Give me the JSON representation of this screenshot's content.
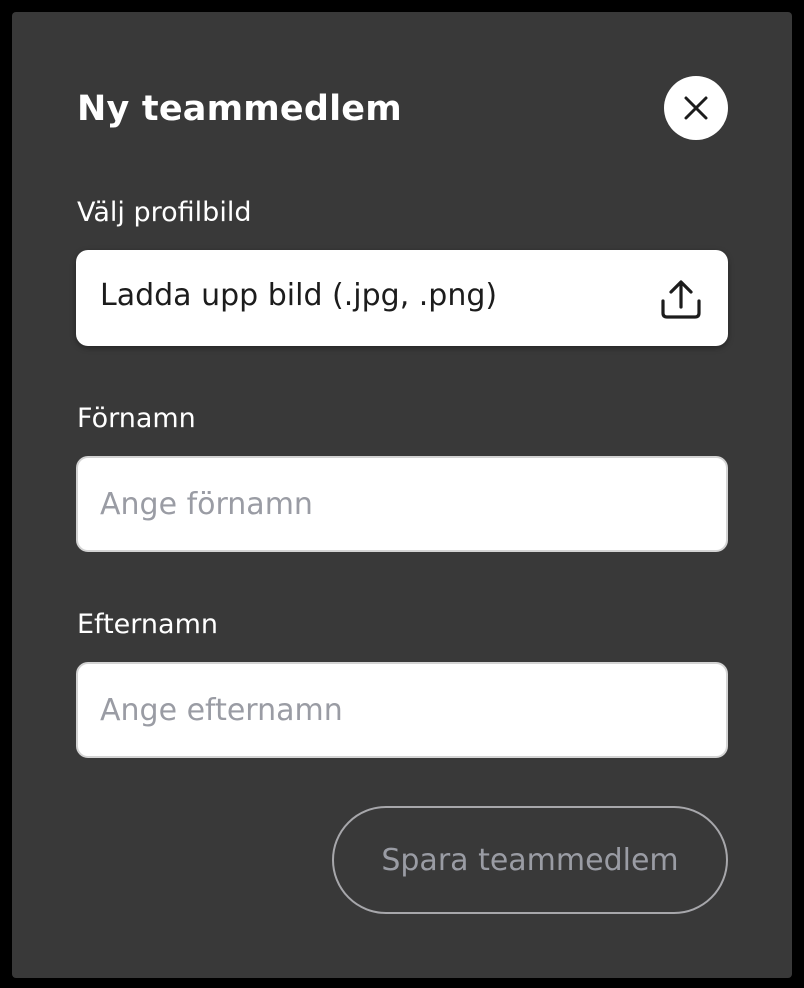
{
  "dialog": {
    "title": "Ny teammedlem",
    "close_icon": "close-icon"
  },
  "profile_image": {
    "label": "Välj profilbild",
    "upload_text": "Ladda upp bild (.jpg, .png)",
    "upload_icon": "upload-icon"
  },
  "first_name": {
    "label": "Förnamn",
    "placeholder": "Ange förnamn",
    "value": ""
  },
  "last_name": {
    "label": "Efternamn",
    "placeholder": "Ange efternamn",
    "value": ""
  },
  "save_button": {
    "label": "Spara teammedlem",
    "state": "disabled"
  },
  "colors": {
    "backdrop": "#000000",
    "dialog_background": "#393939",
    "field_background": "#ffffff",
    "placeholder": "#9a9ca4",
    "disabled_border": "#a7a7ab"
  }
}
